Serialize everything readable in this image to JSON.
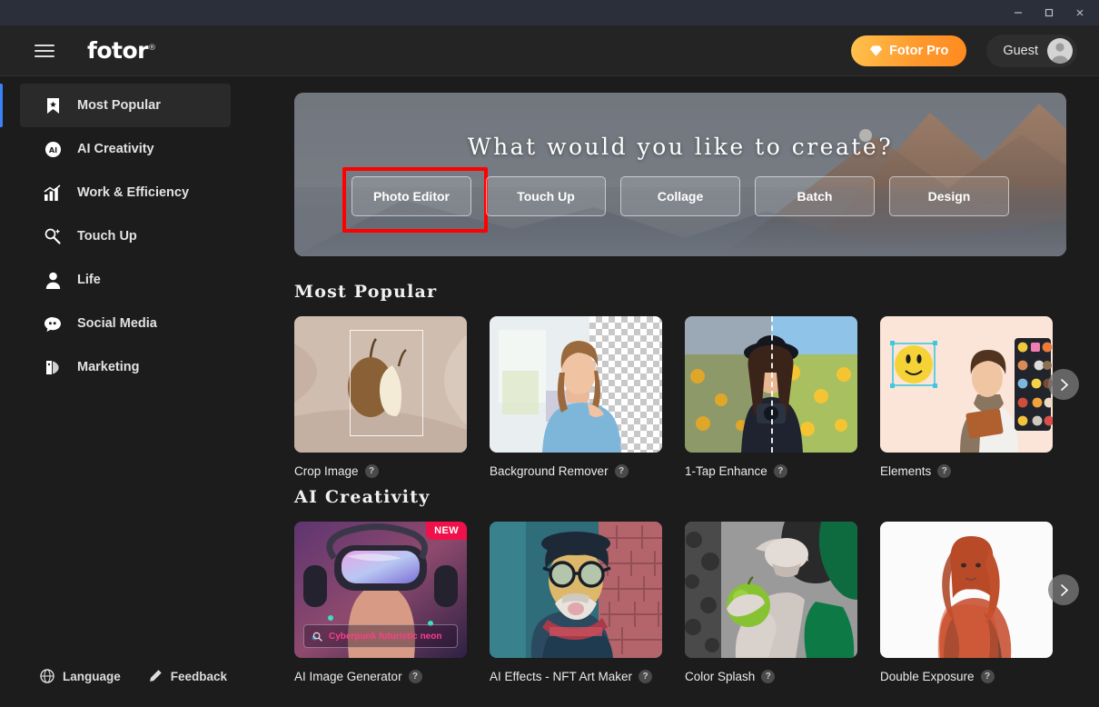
{
  "window": {
    "minimize_label": "Minimize",
    "maximize_label": "Maximize",
    "close_label": "Close"
  },
  "header": {
    "menu_label": "Menu",
    "logo_text": "fotor",
    "logo_mark": "®",
    "pro_button": "Fotor Pro",
    "pro_icon": "diamond-icon",
    "account_name": "Guest"
  },
  "sidebar": {
    "items": [
      {
        "label": "Most Popular",
        "icon": "bookmark-star-icon",
        "active": true
      },
      {
        "label": "AI Creativity",
        "icon": "ai-circle-icon",
        "active": false
      },
      {
        "label": "Work & Efficiency",
        "icon": "bar-chart-icon",
        "active": false
      },
      {
        "label": "Touch Up",
        "icon": "magic-wand-icon",
        "active": false
      },
      {
        "label": "Life",
        "icon": "person-icon",
        "active": false
      },
      {
        "label": "Social Media",
        "icon": "chat-bubble-icon",
        "active": false
      },
      {
        "label": "Marketing",
        "icon": "price-tag-icon",
        "active": false
      }
    ],
    "footer": {
      "language": "Language",
      "language_icon": "globe-icon",
      "feedback": "Feedback",
      "feedback_icon": "pencil-icon"
    }
  },
  "hero": {
    "title": "What would you like to create?",
    "buttons": [
      {
        "label": "Photo Editor",
        "highlighted": true
      },
      {
        "label": "Touch Up",
        "highlighted": false
      },
      {
        "label": "Collage",
        "highlighted": false
      },
      {
        "label": "Batch",
        "highlighted": false
      },
      {
        "label": "Design",
        "highlighted": false
      }
    ],
    "highlight_color": "#ff0000"
  },
  "sections": [
    {
      "title": "Most Popular",
      "cards": [
        {
          "label": "Crop Image",
          "help": "?",
          "badge": ""
        },
        {
          "label": "Background Remover",
          "help": "?",
          "badge": ""
        },
        {
          "label": "1-Tap Enhance",
          "help": "?",
          "badge": ""
        },
        {
          "label": "Elements",
          "help": "?",
          "badge": ""
        }
      ],
      "next_arrow": "chevron-right-icon"
    },
    {
      "title": "AI Creativity",
      "cards": [
        {
          "label": "AI Image Generator",
          "help": "?",
          "badge": "NEW",
          "prompt": "Cyberpunk futuristic neon"
        },
        {
          "label": "AI Effects - NFT Art Maker",
          "help": "?",
          "badge": ""
        },
        {
          "label": "Color Splash",
          "help": "?",
          "badge": ""
        },
        {
          "label": "Double Exposure",
          "help": "?",
          "badge": ""
        }
      ],
      "next_arrow": "chevron-right-icon"
    }
  ],
  "colors": {
    "app_background": "#1c1c1c",
    "header_background": "#242424",
    "titlebar_background": "#2b2f3a",
    "accent_blue": "#3b82f6",
    "pro_orange": "#ff9a2e",
    "badge_red": "#f0114a",
    "prompt_pink": "#ff3d8b"
  }
}
